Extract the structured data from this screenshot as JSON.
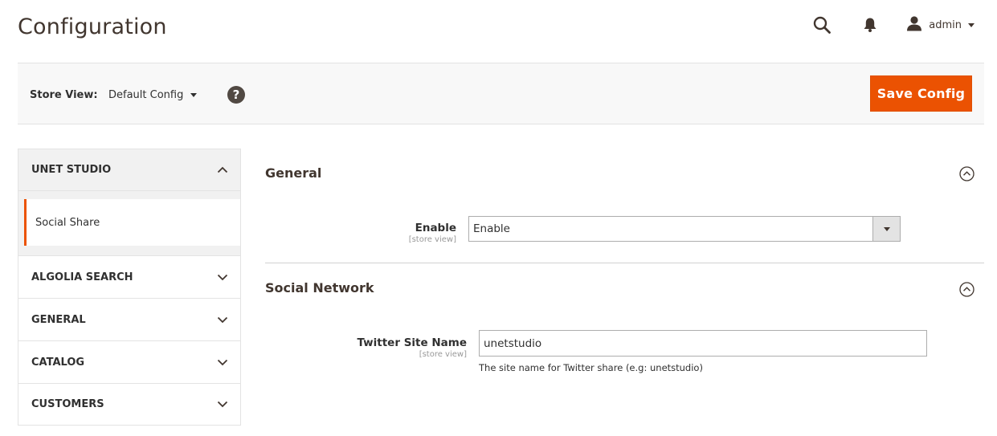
{
  "header": {
    "title": "Configuration",
    "user_name": "admin",
    "search_icon": "search-icon",
    "notification_icon": "bell-icon",
    "user_icon": "user-icon"
  },
  "toolbar": {
    "store_view_label": "Store View:",
    "store_view_value": "Default Config",
    "help_label": "?",
    "save_label": "Save Config"
  },
  "sidebar": {
    "tabs": [
      {
        "label": "UNET STUDIO",
        "expanded": true,
        "items": [
          {
            "label": "Social Share",
            "active": true
          }
        ]
      },
      {
        "label": "ALGOLIA SEARCH",
        "expanded": false
      },
      {
        "label": "GENERAL",
        "expanded": false
      },
      {
        "label": "CATALOG",
        "expanded": false
      },
      {
        "label": "CUSTOMERS",
        "expanded": false
      }
    ]
  },
  "sections": [
    {
      "title": "General",
      "fields": [
        {
          "label": "Enable",
          "scope": "[store view]",
          "type": "select",
          "value": "Enable"
        }
      ]
    },
    {
      "title": "Social Network",
      "fields": [
        {
          "label": "Twitter Site Name",
          "scope": "[store view]",
          "type": "text",
          "value": "unetstudio",
          "note": "The site name for Twitter share (e.g: unetstudio)"
        }
      ]
    }
  ],
  "colors": {
    "accent": "#eb5202",
    "toolbar_bg": "#f8f8f8",
    "title_text": "#41362f"
  }
}
